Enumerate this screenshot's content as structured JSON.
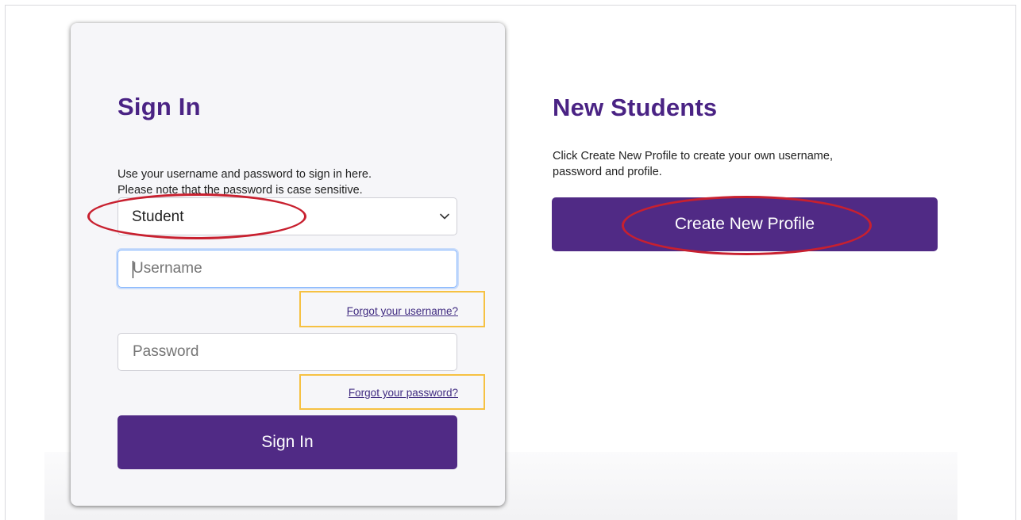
{
  "signin": {
    "title": "Sign In",
    "description_line1": "Use your username and password to sign in here.",
    "description_line2": "Please note that the password is case sensitive.",
    "role_select_value": "Student",
    "username_placeholder": "Username",
    "username_value": "",
    "forgot_username": "Forgot your username?",
    "password_placeholder": "Password",
    "password_value": "",
    "forgot_password": "Forgot your password?",
    "button_label": "Sign In"
  },
  "new_students": {
    "title": "New Students",
    "description_line1": "Click Create New Profile to create your own username,",
    "description_line2": "password and profile.",
    "button_label": "Create New Profile"
  },
  "icons": {
    "select_arrow": "chevron-down-icon"
  },
  "colors": {
    "brand_purple": "#502a85",
    "heading_purple": "#4a2384",
    "annotation_red": "#c8202f",
    "annotation_yellow": "#f6c143",
    "focus_blue": "#86b7fe"
  }
}
